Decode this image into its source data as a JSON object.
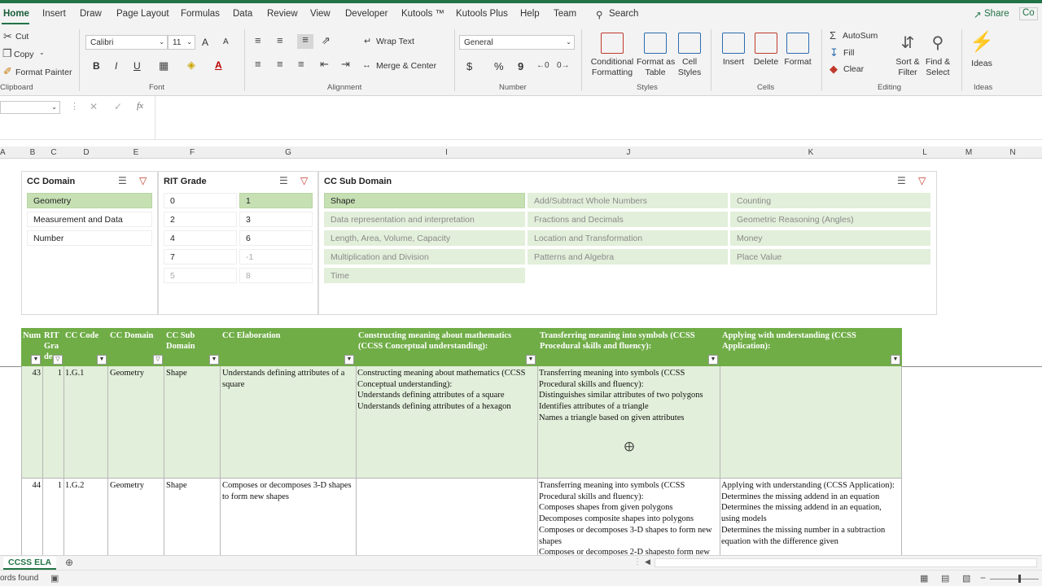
{
  "tabs": [
    "Home",
    "Insert",
    "Draw",
    "Page Layout",
    "Formulas",
    "Data",
    "Review",
    "View",
    "Developer",
    "Kutools ™",
    "Kutools Plus",
    "Help",
    "Team"
  ],
  "tell_me": "Search",
  "share": "Share",
  "comments_partial": "Co",
  "ribbon": {
    "clipboard": {
      "cut": "Cut",
      "copy": "Copy",
      "format_painter": "Format Painter",
      "group": "Clipboard"
    },
    "font": {
      "name": "Calibri",
      "size": "11",
      "bold": "B",
      "italic": "I",
      "underline": "U",
      "font_color_glyph": "A",
      "grow_glyph": "A",
      "shrink_glyph": "A",
      "group": "Font"
    },
    "alignment": {
      "wrap": "Wrap Text",
      "merge": "Merge & Center",
      "group": "Alignment"
    },
    "number": {
      "format": "General",
      "currency": "$",
      "percent": "%",
      "comma": "9",
      "group": "Number"
    },
    "styles": {
      "conditional_1": "Conditional",
      "conditional_2": "Formatting",
      "format_table_1": "Format as",
      "format_table_2": "Table",
      "cell_styles_1": "Cell",
      "cell_styles_2": "Styles",
      "group": "Styles"
    },
    "cells": {
      "insert": "Insert",
      "delete": "Delete",
      "format": "Format",
      "group": "Cells"
    },
    "editing": {
      "autosum": "AutoSum",
      "fill": "Fill",
      "clear": "Clear",
      "sort_1": "Sort &",
      "sort_2": "Filter",
      "find_1": "Find &",
      "find_2": "Select",
      "group": "Editing"
    },
    "ideas": {
      "label": "Ideas",
      "group": "Ideas"
    }
  },
  "formula_bar": {
    "fx": "fx"
  },
  "columns": [
    "A",
    "B",
    "C",
    "D",
    "E",
    "F",
    "G",
    "I",
    "J",
    "K",
    "L",
    "M",
    "N"
  ],
  "slicers": {
    "domain": {
      "title": "CC Domain",
      "items": [
        "Geometry",
        "Measurement and Data",
        "Number"
      ]
    },
    "rit": {
      "title": "RIT Grade",
      "items": [
        "0",
        "1",
        "2",
        "3",
        "4",
        "6",
        "7",
        "-1",
        "5",
        "8"
      ]
    },
    "sub": {
      "title": "CC Sub Domain",
      "items": [
        "Shape",
        "Add/Subtract Whole Numbers",
        "Counting",
        "Data representation and interpretation",
        "Fractions and Decimals",
        "Geometric Reasoning (Angles)",
        "Length, Area, Volume, Capacity",
        "Location and Transformation",
        "Money",
        "Multiplication and Division",
        "Patterns and Algebra",
        "Place Value",
        "Time"
      ]
    }
  },
  "table": {
    "headers": [
      "Num",
      "RIT Gra de",
      "CC Code",
      "CC Domain",
      "CC Sub Domain",
      "CC Elaboration",
      "Constructing meaning about mathematics (CCSS Conceptual understanding):",
      "Transferring meaning into symbols (CCSS Procedural skills and fluency):",
      "Applying with understanding (CCSS Application):"
    ],
    "rows": [
      {
        "num": "43",
        "rit": "1",
        "code": "1.G.1",
        "domain": "Geometry",
        "sub": "Shape",
        "elab": "Understands defining attributes of a square",
        "constructing": [
          "Constructing meaning about mathematics (CCSS Conceptual understanding):",
          "Understands defining attributes of a square",
          "Understands defining attributes of a hexagon"
        ],
        "transferring": [
          "Transferring meaning into symbols (CCSS Procedural skills and fluency):",
          "Distinguishes similar attributes of two polygons",
          "Identifies attributes of a triangle",
          "Names a triangle based on given attributes"
        ],
        "applying": []
      },
      {
        "num": "44",
        "rit": "1",
        "code": "1.G.2",
        "domain": "Geometry",
        "sub": "Shape",
        "elab": "Composes or decomposes 3-D shapes to form new shapes",
        "constructing": [],
        "transferring": [
          "Transferring meaning into symbols (CCSS Procedural skills and fluency):",
          "Composes shapes from given polygons",
          "Decomposes composite shapes into polygons",
          "Composes or decomposes 3-D shapes to form new shapes",
          "Composes or decomposes 2-D shapesto form new"
        ],
        "applying": [
          "Applying with understanding (CCSS Application):",
          "Determines the missing addend in an equation",
          "Determines the missing addend in an equation, using models",
          "Determines the missing number in a subtraction equation with the difference given"
        ]
      }
    ]
  },
  "sheet_tab": "CCSS ELA",
  "status": "ords found"
}
